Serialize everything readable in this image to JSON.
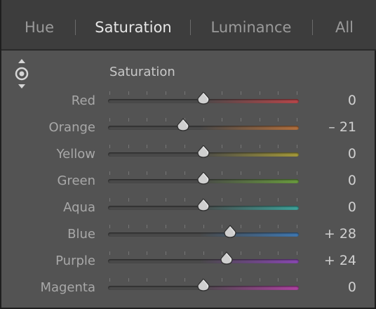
{
  "tabs": [
    {
      "label": "Hue",
      "active": false
    },
    {
      "label": "Saturation",
      "active": true
    },
    {
      "label": "Luminance",
      "active": false
    },
    {
      "label": "All",
      "active": false
    }
  ],
  "section_title": "Saturation",
  "target_adjustment_icon": "targeted-adjustment-icon",
  "slider_range": [
    -100,
    100
  ],
  "rows": [
    {
      "label": "Red",
      "value_text": "0",
      "value": 0,
      "gradient": [
        "#4a4a4a",
        "#b8474a"
      ]
    },
    {
      "label": "Orange",
      "value_text": "– 21",
      "value": -21,
      "gradient": [
        "#4a4a4a",
        "#b2703e"
      ]
    },
    {
      "label": "Yellow",
      "value_text": "0",
      "value": 0,
      "gradient": [
        "#4a4a4a",
        "#a59a3a"
      ]
    },
    {
      "label": "Green",
      "value_text": "0",
      "value": 0,
      "gradient": [
        "#4a4a4a",
        "#6a9c3e"
      ]
    },
    {
      "label": "Aqua",
      "value_text": "0",
      "value": 0,
      "gradient": [
        "#4a4a4a",
        "#3ea39b"
      ]
    },
    {
      "label": "Blue",
      "value_text": "+ 28",
      "value": 28,
      "gradient": [
        "#4a4a4a",
        "#3f78b2"
      ]
    },
    {
      "label": "Purple",
      "value_text": "+ 24",
      "value": 24,
      "gradient": [
        "#4a4a4a",
        "#8a48b3"
      ]
    },
    {
      "label": "Magenta",
      "value_text": "0",
      "value": 0,
      "gradient": [
        "#4a4a4a",
        "#b043a3"
      ]
    }
  ]
}
